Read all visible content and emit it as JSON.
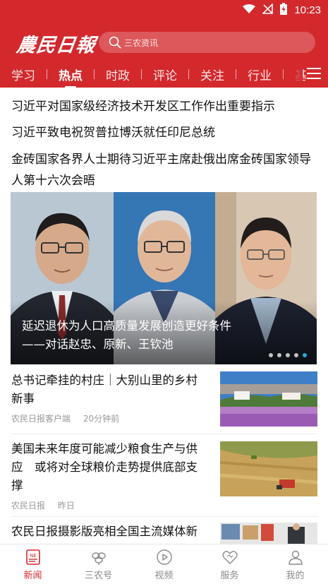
{
  "status_bar": {
    "time": "10:23"
  },
  "header": {
    "logo_text": "農民日報",
    "search": {
      "placeholder": "三农资讯"
    },
    "tabs": [
      {
        "label": "学习",
        "active": false
      },
      {
        "label": "热点",
        "active": true
      },
      {
        "label": "时政",
        "active": false
      },
      {
        "label": "评论",
        "active": false
      },
      {
        "label": "关注",
        "active": false
      },
      {
        "label": "行业",
        "active": false
      },
      {
        "label": "基",
        "active": false
      }
    ],
    "menu_icon": "menu-icon"
  },
  "headlines": [
    "习近平对国家级经济技术开发区工作作出重要指示",
    "习近平致电祝贺普拉博沃就任印尼总统",
    "金砖国家各界人士期待习近平主席赴俄出席金砖国家领导人第十六次会晤"
  ],
  "banner": {
    "caption_line1": "延迟退休为人口高质量发展创造更好条件",
    "caption_line2": "——对话赵忠、原新、王钦池",
    "dot_count": 5,
    "active_dot": 4
  },
  "news": [
    {
      "title": "总书记牵挂的村庄｜大别山里的乡村新事",
      "source": "农民日报客户端",
      "time": "20分钟前",
      "thumb": "village-photo"
    },
    {
      "title": "美国未来年度可能减少粮食生产与供应　或将对全球粮价走势提供底部支撑",
      "source": "农民日报",
      "time": "昨日",
      "thumb": "harvest-photo"
    },
    {
      "title": "农民日报摄影版亮相全国主流媒体新",
      "source": "",
      "time": "",
      "thumb": "exhibition-photo"
    }
  ],
  "bottom_nav": [
    {
      "label": "新闻",
      "icon": "news-icon",
      "active": true
    },
    {
      "label": "三农号",
      "icon": "leaf-icon",
      "active": false
    },
    {
      "label": "视频",
      "icon": "play-icon",
      "active": false
    },
    {
      "label": "服务",
      "icon": "heart-icon",
      "active": false
    },
    {
      "label": "我的",
      "icon": "user-icon",
      "active": false
    }
  ],
  "colors": {
    "brand_red": "#d3292d",
    "active_dot": "#2aa8e0",
    "muted_text": "#999999"
  }
}
